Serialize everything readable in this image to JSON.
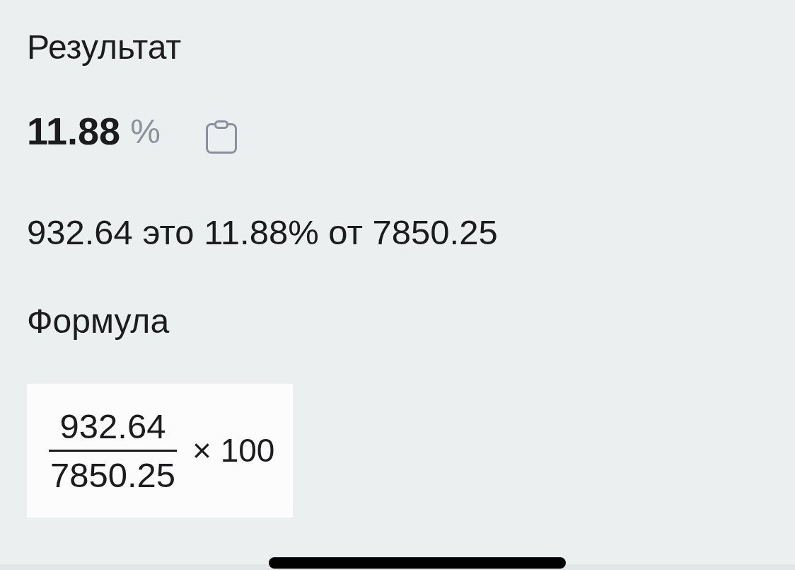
{
  "result": {
    "heading": "Результат",
    "value": "11.88",
    "unit": "%"
  },
  "sentence": "932.64 это 11.88% от 7850.25",
  "formula": {
    "heading": "Формула",
    "numerator": "932.64",
    "denominator": "7850.25",
    "multiplier": "× 100"
  }
}
